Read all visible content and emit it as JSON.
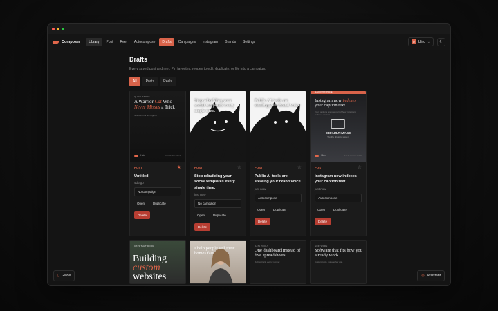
{
  "window": {
    "dots": [
      "#ff5f57",
      "#febc2e",
      "#28c840"
    ]
  },
  "app": {
    "name": "Composer"
  },
  "nav": {
    "items": [
      "Library",
      "Post",
      "Reel",
      "Autocompose",
      "Drafts",
      "Campaigns",
      "Instagram",
      "Brands",
      "Settings"
    ],
    "active": "Drafts"
  },
  "user": {
    "initial": "U",
    "name": "Ulric",
    "chevron": "⌄"
  },
  "theme_toggle": {
    "icon": "moon-icon",
    "glyph": "☾"
  },
  "page": {
    "title": "Drafts",
    "subtitle": "Every saved post and reel. Pin favorites, reopen to edit, duplicate, or file into a campaign."
  },
  "filters": [
    "All",
    "Posts",
    "Reels"
  ],
  "labels": {
    "open": "Open",
    "duplicate": "Duplicate",
    "delete": "Delete"
  },
  "cards": [
    {
      "tag": "POST",
      "favorited": true,
      "title": "Untitled",
      "time": "4d ago",
      "campaign": "No campaign",
      "preview": {
        "kicker": "QUICK STORY",
        "line1": "A Warrior ",
        "accent1": "Cat",
        "line1b": " Who",
        "accent2": "Never Misses",
        "line2b": " a Trick",
        "caption": "Notes from a tiny legend",
        "footer_name": "Ulric",
        "footer_right": "SWIPE TO READ"
      }
    },
    {
      "tag": "POST",
      "favorited": false,
      "title": "Stop rebuilding your social templates every single time.",
      "time": "just now",
      "campaign": "No campaign",
      "preview": {
        "overlay": "Stop rebuilding your social templates every single time."
      }
    },
    {
      "tag": "POST",
      "favorited": false,
      "title": "Public AI tools are stealing your brand voice",
      "time": "just now",
      "campaign": "Autocompose",
      "preview": {
        "overlay": "Public AI tools are stealing your brand voice"
      }
    },
    {
      "tag": "POST",
      "favorited": false,
      "title": "Instagram now indexes your caption text.",
      "time": "just now",
      "campaign": "Autocompose",
      "preview": {
        "bar": "ALGORITHM UPDATE",
        "line1": "Instagram now ",
        "accent": "indexes",
        "line2": "your caption text.",
        "caption": "Your captions are now part of how Instagram surfaces content.",
        "default_label": "DEFAULT IMAGE",
        "default_sub": "Tap the photo to swap it",
        "footer_name": "Ulric",
        "footer_right": "SAVE FOR LATER"
      }
    }
  ],
  "row2": [
    {
      "kicker": "CATS THAT DOOR",
      "big1": "Building",
      "big2": "custom",
      "big3": "websites"
    },
    {
      "headline": "I help people sell their homes fast"
    },
    {
      "kicker": "DATA TOOLS",
      "headline": "One dashboard instead of five spreadsheets",
      "caption": "Built to track, every number."
    },
    {
      "kicker": "SOFTWARE",
      "headline": "Software that fits how you already work",
      "caption": "Custom tools, not another app."
    }
  ],
  "footer_buttons": {
    "guide": "Guide",
    "assistant": "Assistant"
  },
  "colors": {
    "accent": "#d8634a",
    "danger": "#b83e32",
    "bg": "#141414"
  }
}
